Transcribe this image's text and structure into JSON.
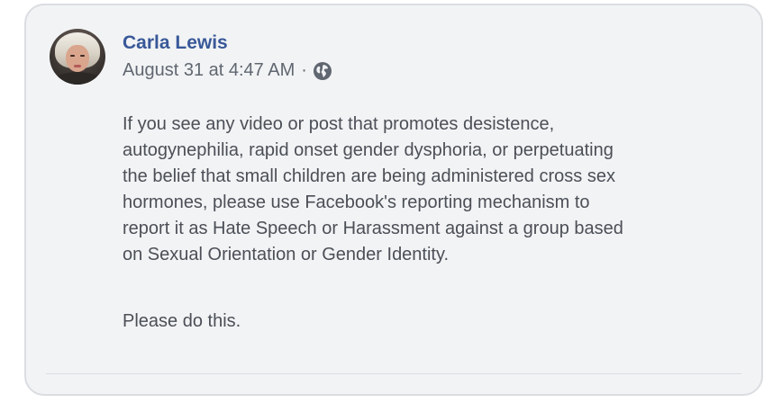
{
  "post": {
    "author": "Carla Lewis",
    "timestamp": "August 31 at 4:47 AM",
    "separator": "·",
    "privacy_icon": "globe-icon",
    "body_lines": [
      "If you see any video or post that promotes desistence,",
      "autogynephilia, rapid onset gender dysphoria, or perpetuating",
      "the belief that small children are being administered cross sex",
      "hormones, please use Facebook's reporting mechanism to",
      "report it as Hate Speech or Harassment against a group based",
      "on Sexual Orientation or Gender Identity."
    ],
    "closing": "Please do this."
  },
  "colors": {
    "author_link": "#385898",
    "meta_text": "#606770",
    "body_text": "#4b4f56",
    "card_background": "#f2f3f5",
    "card_border": "#dadde1"
  }
}
